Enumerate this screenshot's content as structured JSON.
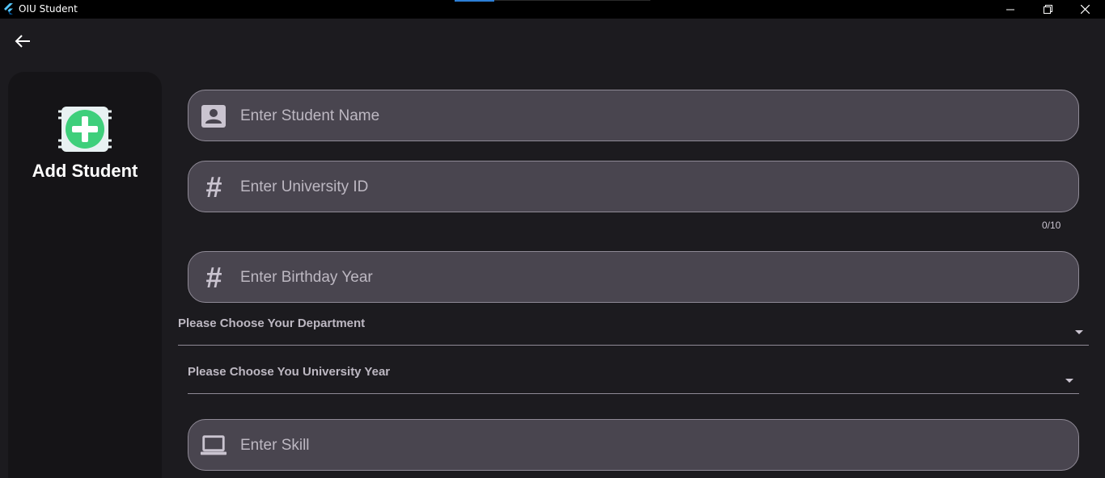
{
  "window": {
    "title": "OIU Student",
    "icons": {
      "logo": "flutter-logo-icon",
      "minimize": "minimize-icon",
      "maximize": "restore-icon",
      "close": "close-icon"
    }
  },
  "nav": {
    "back_icon": "arrow-back-icon"
  },
  "side_panel": {
    "logo_icon": "add-student-icon",
    "title": "Add Student",
    "accent_color": "#3ecf7b"
  },
  "form": {
    "student_name": {
      "placeholder": "Enter Student Name",
      "icon": "contact-card-icon"
    },
    "university_id": {
      "placeholder": "Enter University ID",
      "icon": "hash-icon",
      "counter": "0/10"
    },
    "birthday_year": {
      "placeholder": "Enter Birthday Year",
      "icon": "hash-icon"
    },
    "department": {
      "label": "Please Choose Your Department"
    },
    "university_year": {
      "label": "Please Choose You University Year"
    },
    "skill": {
      "placeholder": "Enter Skill",
      "icon": "laptop-icon"
    }
  }
}
